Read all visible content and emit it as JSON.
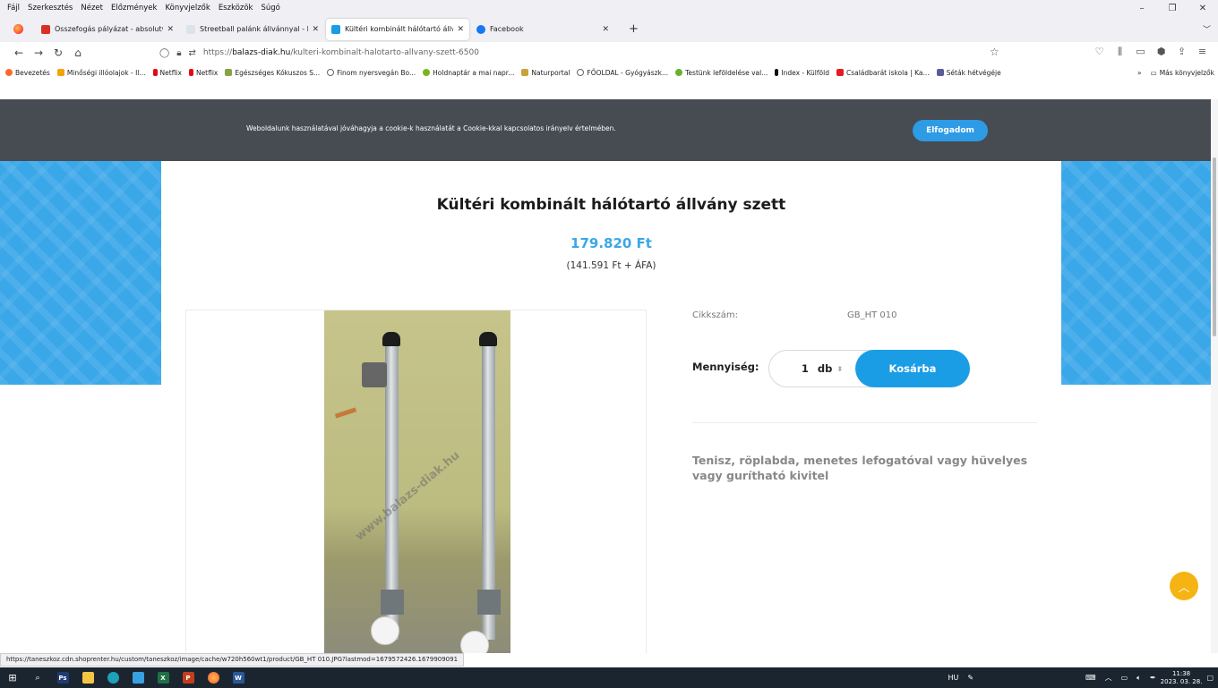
{
  "menu": [
    "Fájl",
    "Szerkesztés",
    "Nézet",
    "Előzmények",
    "Könyvjelzők",
    "Eszközök",
    "Súgó"
  ],
  "tabs": [
    {
      "label": "Összefogás pályázat - absolutvil",
      "fav_color": "#d93025",
      "active": false
    },
    {
      "label": "Streetball palánk állvánnyal - Ko",
      "fav_color": "#dde3ea",
      "active": false
    },
    {
      "label": "Kültéri kombinált hálótartó állva",
      "fav_color": "#1b9de6",
      "active": true
    },
    {
      "label": "Facebook",
      "fav_color": "#1877f2",
      "active": false
    }
  ],
  "url": {
    "scheme": "https://",
    "host": "balazs-diak.hu",
    "path": "/kulteri-kombinalt-halotarto-allvany-szett-6500"
  },
  "bookmarks": [
    {
      "label": "Bevezetés",
      "color": "#ff6a2b"
    },
    {
      "label": "Minőségi illóolajok - Il...",
      "color": "#f0a500"
    },
    {
      "label": "Netflix",
      "color": "#e50914"
    },
    {
      "label": "Netflix",
      "color": "#e50914"
    },
    {
      "label": "Egészséges Kókuszos S...",
      "color": "#8aa14a"
    },
    {
      "label": "Finom nyersvegán Bo...",
      "color": "#666666"
    },
    {
      "label": "Holdnaptár a mai napr...",
      "color": "#7ab51d"
    },
    {
      "label": "Naturportal",
      "color": "#c8a33b"
    },
    {
      "label": "FŐOLDAL - Gyógyászk...",
      "color": "#666666"
    },
    {
      "label": "Testünk leföldelése val...",
      "color": "#69b12d"
    },
    {
      "label": "Index - Külföld",
      "color": "#111111"
    },
    {
      "label": "Családbarát iskola | Ka...",
      "color": "#e31b23"
    },
    {
      "label": "Séták hétvégéje",
      "color": "#5b5b9b"
    }
  ],
  "bookmarks_more": "Más könyvjelzők",
  "cookie": {
    "text": "Weboldalunk használatával jóváhagyja a cookie-k használatát a Cookie-kkal kapcsolatos irányelv értelmében.",
    "button": "Elfogadom"
  },
  "product": {
    "title": "Kültéri kombinált hálótartó állvány szett",
    "price": "179.820 Ft",
    "net_price": "(141.591 Ft + ÁFA)",
    "sku_label": "Cikkszám:",
    "sku": "GB_HT 010",
    "qty_label": "Mennyiség:",
    "qty": "1",
    "unit": "db",
    "add_to_cart": "Kosárba",
    "description": "Tenisz, röplabda, menetes lefogatóval vagy hüvelyes vagy gurítható kivitel",
    "watermark": "www.balazs-diak.hu"
  },
  "status_url": "https://taneszkoz.cdn.shoprenter.hu/custom/taneszkoz/image/cache/w720h560wt1/product/GB_HT 010.JPG?lastmod=1679572426.1679909091",
  "taskbar": {
    "lang": "HU",
    "time": "11:38",
    "date": "2023. 03. 28."
  }
}
